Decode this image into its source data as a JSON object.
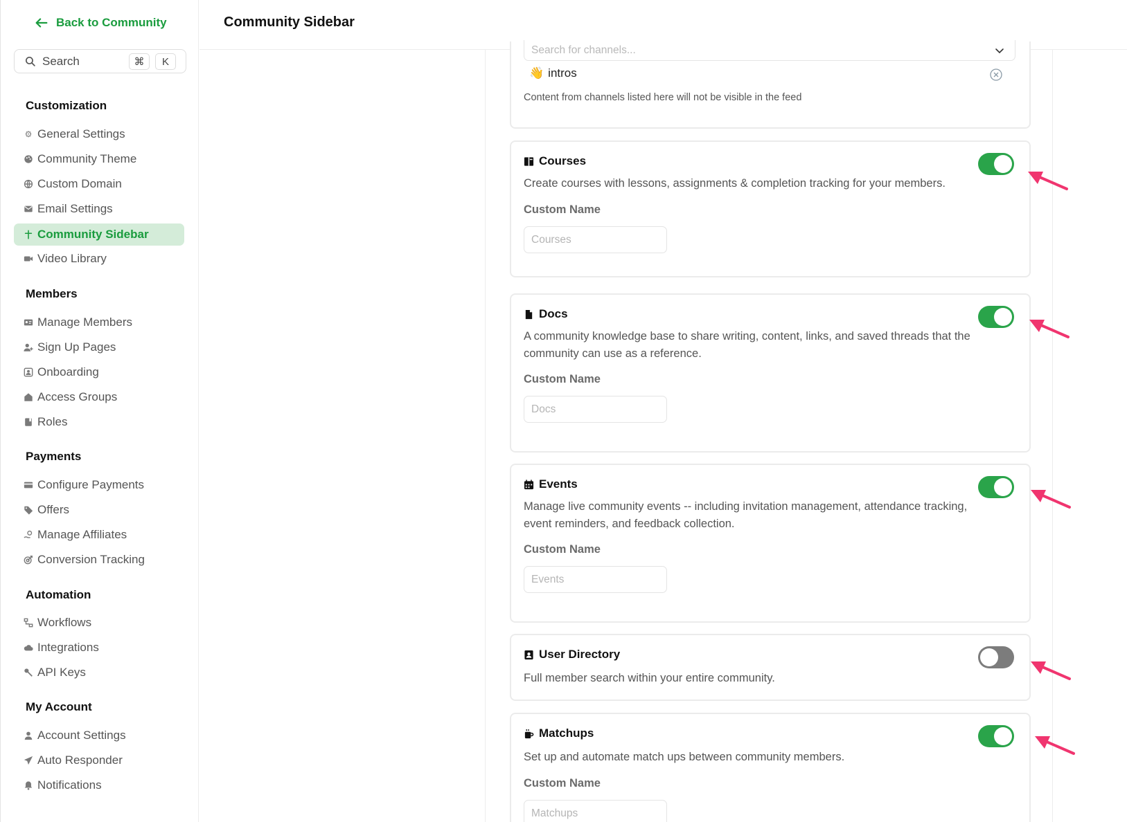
{
  "sidebar": {
    "back_label": "Back to Community",
    "search": {
      "label": "Search",
      "shortcut_mod": "⌘",
      "shortcut_key": "K"
    },
    "sections": [
      {
        "title": "Customization",
        "items": [
          "General Settings",
          "Community Theme",
          "Custom Domain",
          "Email Settings",
          "Community Sidebar",
          "Video Library"
        ]
      },
      {
        "title": "Members",
        "items": [
          "Manage Members",
          "Sign Up Pages",
          "Onboarding",
          "Access Groups",
          "Roles"
        ]
      },
      {
        "title": "Payments",
        "items": [
          "Configure Payments",
          "Offers",
          "Manage Affiliates",
          "Conversion Tracking"
        ]
      },
      {
        "title": "Automation",
        "items": [
          "Workflows",
          "Integrations",
          "API Keys"
        ]
      },
      {
        "title": "My Account",
        "items": [
          "Account Settings",
          "Auto Responder",
          "Notifications"
        ]
      }
    ],
    "active_item": "Community Sidebar"
  },
  "header": {
    "title": "Community Sidebar"
  },
  "channels": {
    "placeholder": "Search for channels...",
    "chip_emoji": "👋",
    "chip_label": "intros",
    "note": "Content from channels listed here will not be visible in the feed"
  },
  "features": [
    {
      "title": "Courses",
      "icon": "book-icon",
      "enabled": true,
      "description": "Create courses with lessons, assignments & completion tracking for your members.",
      "custom_name_label": "Custom Name",
      "custom_name_placeholder": "Courses"
    },
    {
      "title": "Docs",
      "icon": "document-icon",
      "enabled": true,
      "description": "A community knowledge base to share writing, content, links, and saved threads that the community can use as a reference.",
      "custom_name_label": "Custom Name",
      "custom_name_placeholder": "Docs"
    },
    {
      "title": "Events",
      "icon": "calendar-icon",
      "enabled": true,
      "description": "Manage live community events -- including invitation management, attendance tracking, event reminders, and feedback collection.",
      "custom_name_label": "Custom Name",
      "custom_name_placeholder": "Events"
    },
    {
      "title": "User Directory",
      "icon": "address-book-icon",
      "enabled": false,
      "description": "Full member search within your entire community."
    },
    {
      "title": "Matchups",
      "icon": "mug-icon",
      "enabled": true,
      "description": "Set up and automate match ups between community members.",
      "custom_name_label": "Custom Name",
      "custom_name_placeholder": "Matchups"
    }
  ],
  "colors": {
    "accent": "#1a9c3e",
    "toggle_on": "#2aa44a",
    "toggle_off": "#7c7c7c",
    "active_bg": "#d4ecd9",
    "annotation_arrow": "#f0356f"
  }
}
